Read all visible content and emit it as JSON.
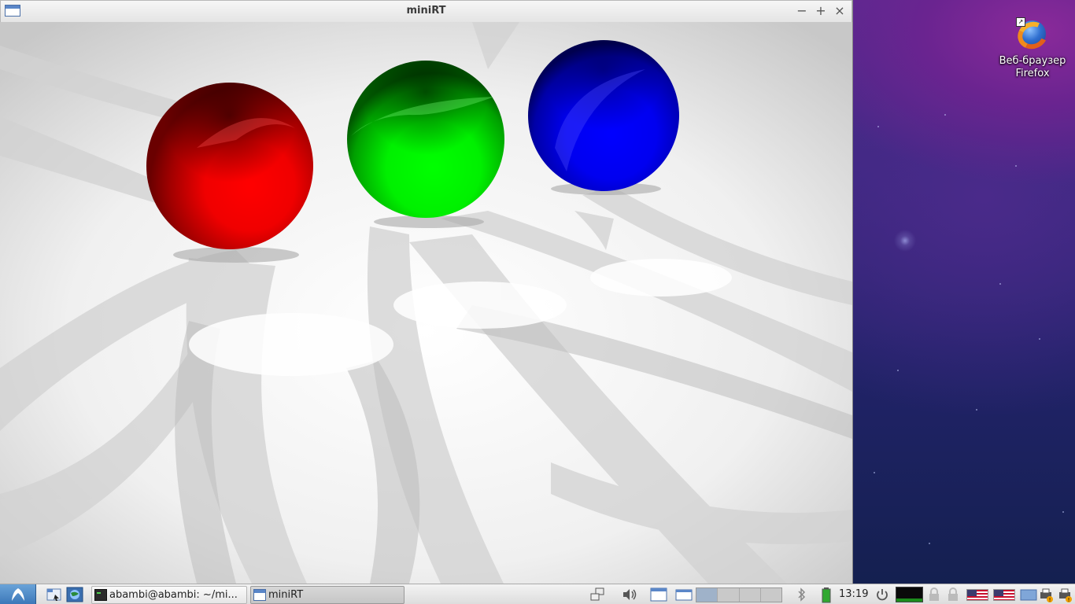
{
  "window": {
    "title": "miniRT",
    "controls": {
      "minimize": "−",
      "maximize": "+",
      "close": "×"
    }
  },
  "scene": {
    "spheres": [
      {
        "name": "red-sphere",
        "color": "#ff0000"
      },
      {
        "name": "green-sphere",
        "color": "#00ff00"
      },
      {
        "name": "blue-sphere",
        "color": "#0000ff"
      }
    ],
    "background": "#ffffff"
  },
  "desktop": {
    "icons": [
      {
        "label_line1": "Веб-браузер",
        "label_line2": "Firefox",
        "icon": "firefox-icon"
      }
    ]
  },
  "taskbar": {
    "tasks": [
      {
        "label": "abambi@abambi: ~/mi...",
        "icon": "terminal-icon"
      },
      {
        "label": "miniRT",
        "icon": "window-icon",
        "active": true
      }
    ],
    "clock": "13:19",
    "workspaces": 4
  }
}
